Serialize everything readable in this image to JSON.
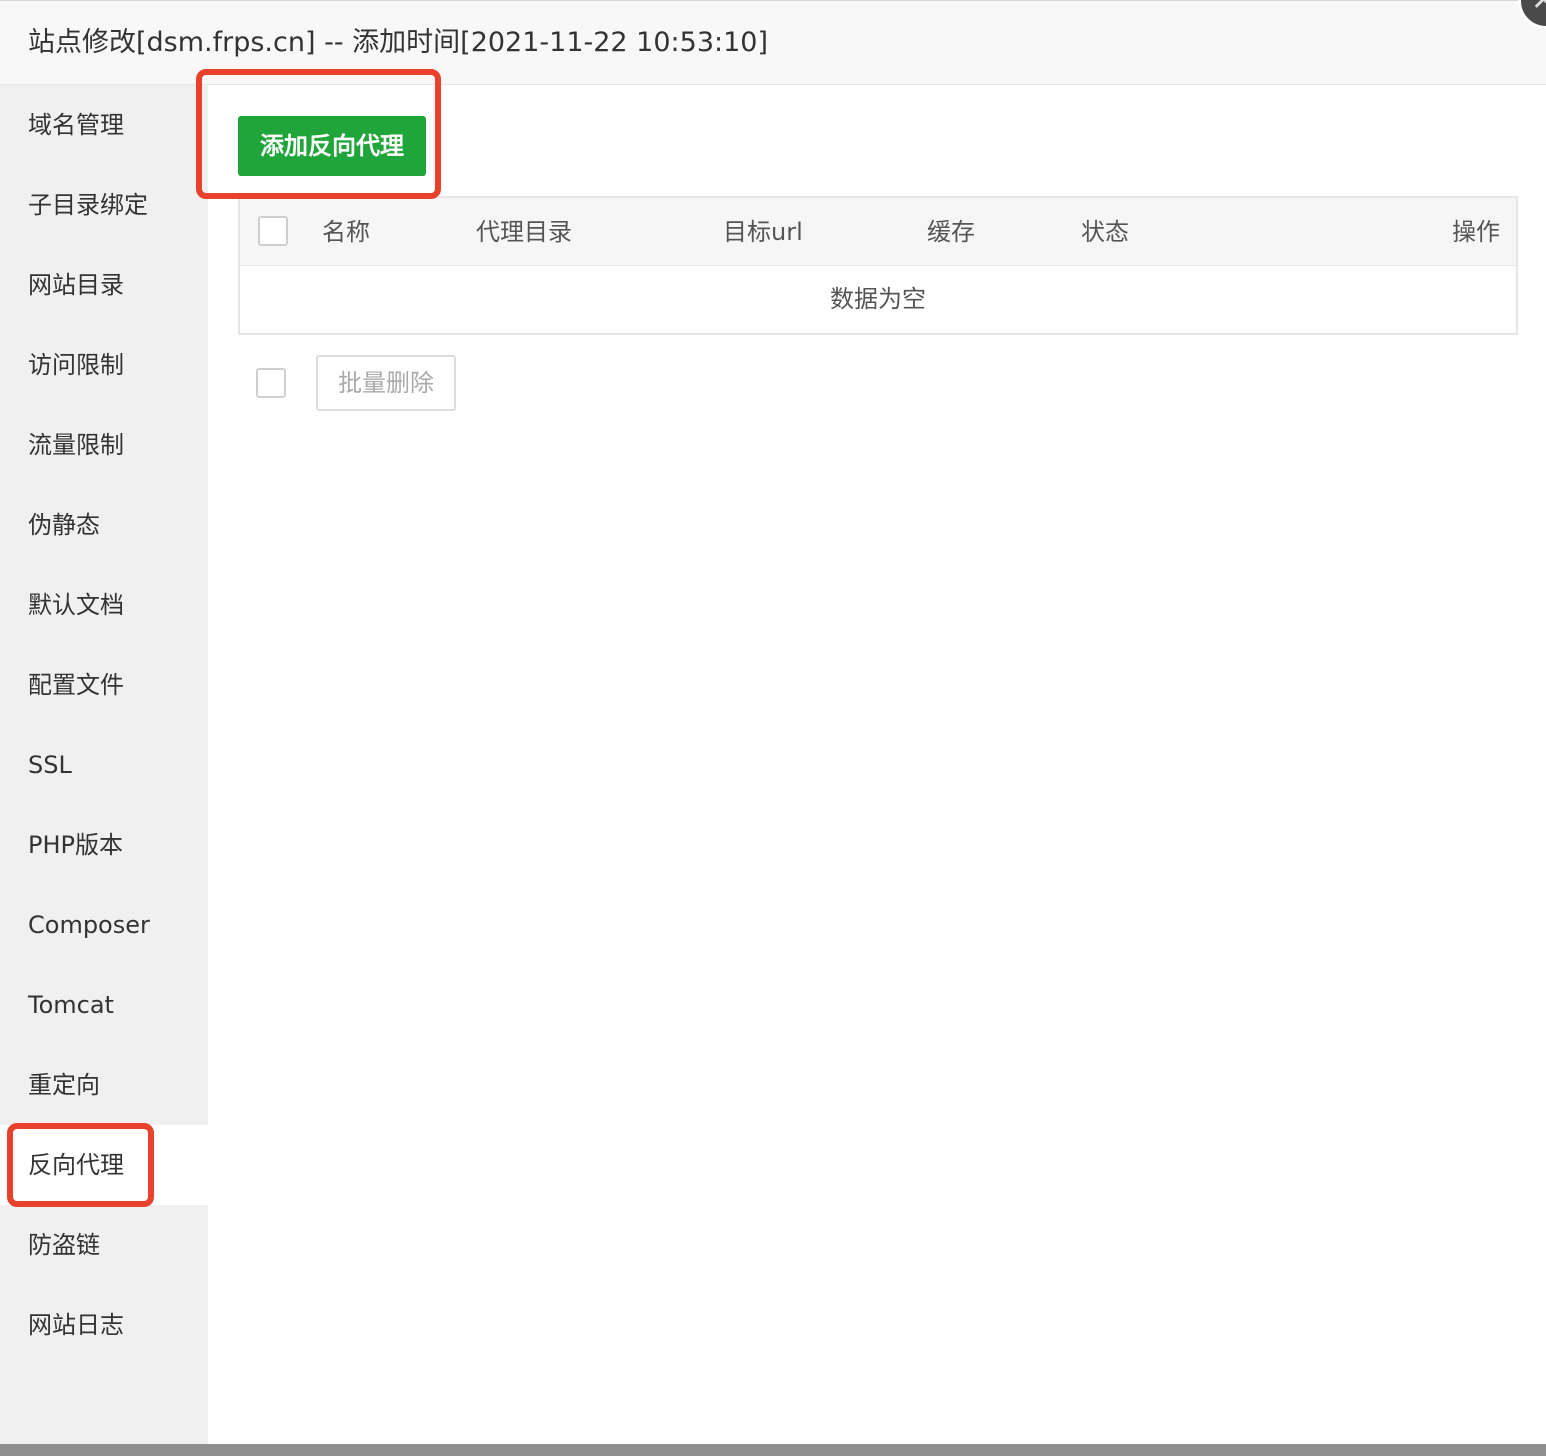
{
  "dialog": {
    "title": "站点修改[dsm.frps.cn] -- 添加时间[2021-11-22 10:53:10]",
    "close_icon": "close-icon"
  },
  "sidebar": {
    "items": [
      {
        "label": "域名管理"
      },
      {
        "label": "子目录绑定"
      },
      {
        "label": "网站目录"
      },
      {
        "label": "访问限制"
      },
      {
        "label": "流量限制"
      },
      {
        "label": "伪静态"
      },
      {
        "label": "默认文档"
      },
      {
        "label": "配置文件"
      },
      {
        "label": "SSL"
      },
      {
        "label": "PHP版本"
      },
      {
        "label": "Composer"
      },
      {
        "label": "Tomcat"
      },
      {
        "label": "重定向"
      },
      {
        "label": "反向代理",
        "active": true
      },
      {
        "label": "防盗链"
      },
      {
        "label": "网站日志"
      }
    ]
  },
  "toolbar": {
    "add_label": "添加反向代理"
  },
  "table": {
    "columns": [
      "名称",
      "代理目录",
      "目标url",
      "缓存",
      "状态",
      "操作"
    ],
    "rows": [],
    "empty_text": "数据为空"
  },
  "footer": {
    "batch_delete_label": "批量删除"
  },
  "colors": {
    "accent_green": "#20a53a",
    "highlight_red": "#e8412c",
    "sidebar_bg": "#f0f0f0"
  }
}
